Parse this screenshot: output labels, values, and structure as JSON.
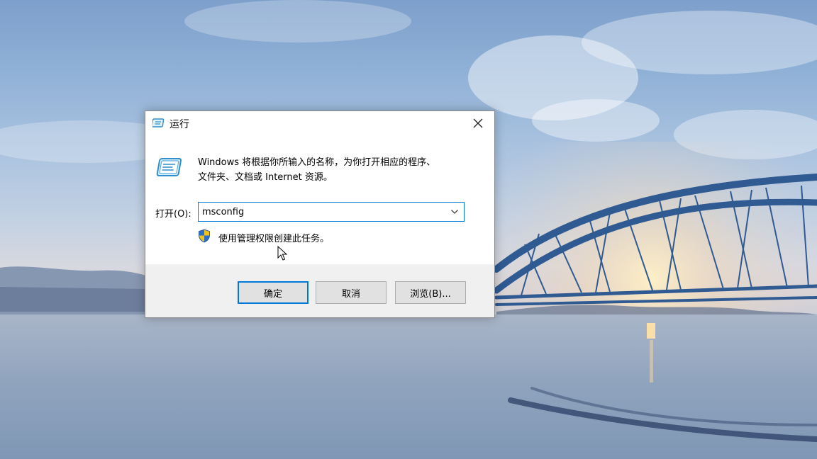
{
  "dialog": {
    "title": "运行",
    "description_line1": "Windows 将根据你所输入的名称，为你打开相应的程序、",
    "description_line2": "文件夹、文档或 Internet 资源。",
    "open_label": "打开(O):",
    "open_value": "msconfig",
    "admin_note": "使用管理权限创建此任务。",
    "ok_label": "确定",
    "cancel_label": "取消",
    "browse_label": "浏览(B)..."
  },
  "icons": {
    "title": "run-icon",
    "body": "run-icon",
    "shield": "uac-shield-icon",
    "close": "close-icon",
    "dropdown": "chevron-down-icon",
    "cursor": "mouse-pointer-icon"
  },
  "colors": {
    "accent": "#0078d7",
    "footer": "#f0f0f0",
    "button": "#e1e1e1"
  }
}
